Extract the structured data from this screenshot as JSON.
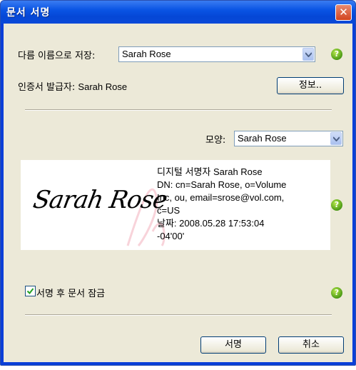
{
  "window": {
    "title": "문서 서명",
    "close_glyph": "✕"
  },
  "sign_as": {
    "label": "다름 이름으로 저장:",
    "value": "Sarah Rose"
  },
  "issuer": {
    "label": "인증서 발급자:",
    "value": "Sarah Rose",
    "info_button": "정보.."
  },
  "appearance": {
    "label": "모양:",
    "value": "Sarah Rose"
  },
  "signature_preview": {
    "handwritten": "Sarah Rose",
    "lines": [
      "디지털 서명자 Sarah Rose",
      "DN: cn=Sarah Rose, o=Volume",
      "Inc, ou, email=srose@vol.com,",
      "c=US",
      "날짜:  2008.05.28 17:53:04",
      "-04'00'"
    ]
  },
  "lock": {
    "label": "서명 후 문서 잠금",
    "checked": true
  },
  "buttons": {
    "sign": "서명",
    "cancel": "취소"
  },
  "help_glyph": "?",
  "colors": {
    "titlebar": "#0a54e4",
    "client": "#ece9d8",
    "help": "#4b9a16",
    "close": "#d2441f"
  }
}
